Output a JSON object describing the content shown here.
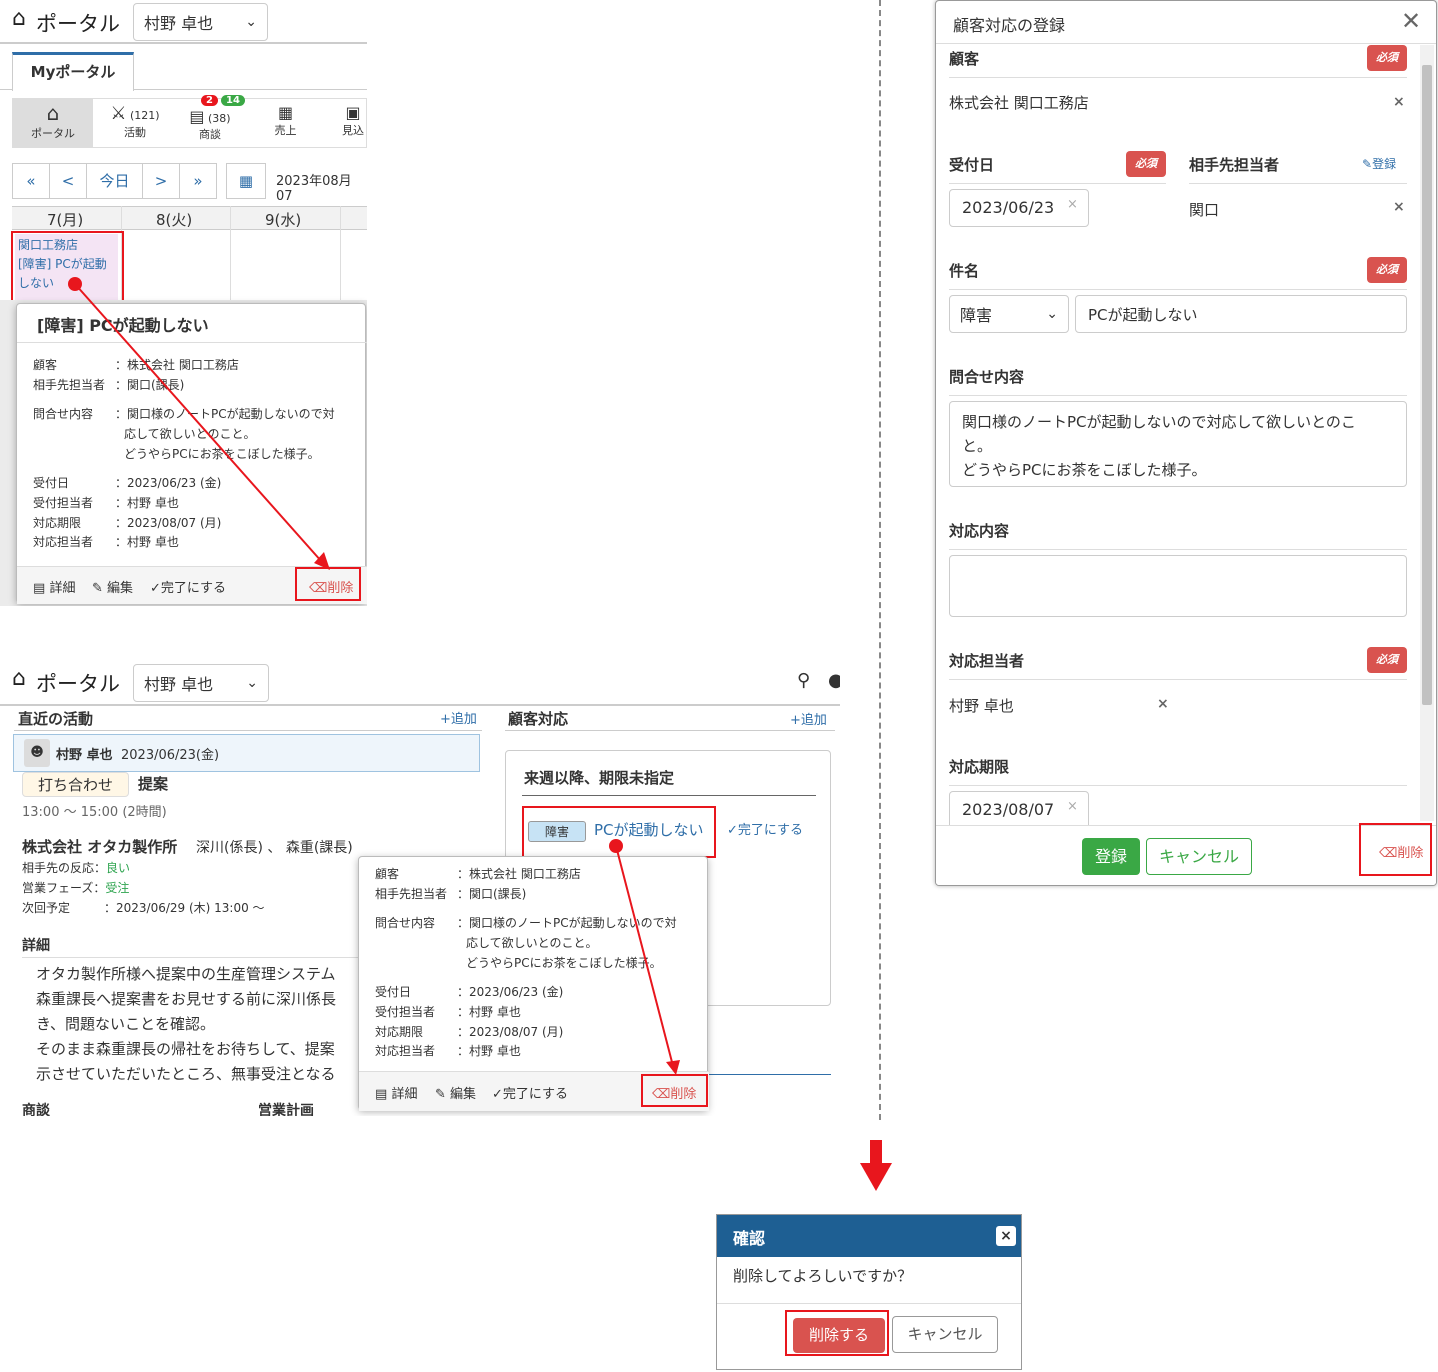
{
  "top_portal": {
    "title": "ポータル",
    "user_select": "村野 卓也",
    "tab": "Myポータル",
    "toolbar": [
      {
        "label": "ポータル",
        "count": ""
      },
      {
        "label": "活動",
        "count": "(121)"
      },
      {
        "label": "商談",
        "count": "(38)",
        "badge_red": "2",
        "badge_green": "14"
      },
      {
        "label": "売上",
        "count": ""
      },
      {
        "label": "見込",
        "count": ""
      }
    ],
    "nav": {
      "first": "«",
      "prev": "<",
      "today": "今日",
      "next": ">",
      "last": "»"
    },
    "date": "2023年08月07",
    "days": [
      "7(月)",
      "8(火)",
      "9(水)"
    ],
    "event_lines": [
      "関口工務店",
      "[障害] PCが起動",
      "しない"
    ],
    "popup": {
      "title": "[障害] PCが起動しない",
      "rows": [
        {
          "k": "顧客",
          "v": "：株式会社 関口工務店"
        },
        {
          "k": "相手先担当者",
          "v": "：関口(課長)"
        },
        {
          "k": "問合せ内容",
          "v": "：関口様のノートPCが起動しないので対"
        },
        {
          "k": "",
          "v": "応して欲しいとのこと。"
        },
        {
          "k": "",
          "v": "どうやらPCにお茶をこぼした様子。"
        },
        {
          "k": "受付日",
          "v": "：2023/06/23 (金)"
        },
        {
          "k": "受付担当者",
          "v": "：村野 卓也"
        },
        {
          "k": "対応期限",
          "v": "：2023/08/07 (月)"
        },
        {
          "k": "対応担当者",
          "v": "：村野 卓也"
        }
      ],
      "actions": {
        "detail": "詳細",
        "edit": "編集",
        "complete": "完了にする",
        "delete": "削除"
      }
    }
  },
  "bottom_portal": {
    "title": "ポータル",
    "user_select": "村野 卓也",
    "recent_title": "直近の活動",
    "add_label": "追加",
    "activity_user": "村野 卓也",
    "activity_date": "2023/06/23(金)",
    "activity_tag": "打ち合わせ",
    "activity_type": "提案",
    "activity_time": "13:00 ～ 15:00 (2時間)",
    "company": "株式会社 オタカ製作所",
    "contacts": "深川(係長) 、 森重(課長)",
    "reaction_label": "相手先の反応：",
    "reaction_value": "良い",
    "phase_label": "営業フェーズ：",
    "phase_value": "受注",
    "next_label": "次回予定",
    "next_value": "：2023/06/29 (木) 13:00 ～",
    "detail_title": "詳細",
    "detail_lines": [
      "オタカ製作所様へ提案中の生産管理システム",
      "森重課長へ提案書をお見せする前に深川係長",
      "き、問題ないことを確認。",
      "そのまま森重課長の帰社をお待ちして、提案",
      "示させていただいたところ、無事受注となる"
    ],
    "footer_left": "商談",
    "footer_right": "営業計画",
    "cs_title": "顧客対応",
    "cs_card_title": "来週以降、期限未指定",
    "cs_tag": "障害",
    "cs_link": "PCが起動しない",
    "cs_complete": "完了にする",
    "popup": {
      "rows": [
        {
          "k": "顧客",
          "v": "：株式会社 関口工務店"
        },
        {
          "k": "相手先担当者",
          "v": "：関口(課長)"
        },
        {
          "k": "問合せ内容",
          "v": "：関口様のノートPCが起動しないので対"
        },
        {
          "k": "",
          "v": "応して欲しいとのこと。"
        },
        {
          "k": "",
          "v": "どうやらPCにお茶をこぼした様子。"
        },
        {
          "k": "受付日",
          "v": "：2023/06/23 (金)"
        },
        {
          "k": "受付担当者",
          "v": "：村野 卓也"
        },
        {
          "k": "対応期限",
          "v": "：2023/08/07 (月)"
        },
        {
          "k": "対応担当者",
          "v": "：村野 卓也"
        }
      ],
      "actions": {
        "detail": "詳細",
        "edit": "編集",
        "complete": "完了にする",
        "delete": "削除"
      }
    }
  },
  "modal": {
    "title": "顧客対応の登録",
    "required": "必須",
    "customer_label": "顧客",
    "customer_value": "株式会社 関口工務店",
    "received_label": "受付日",
    "received_value": "2023/06/23",
    "contact_label": "相手先担当者",
    "contact_register": "登録",
    "contact_value": "関口",
    "subject_label": "件名",
    "subject_category": "障害",
    "subject_value": "PCが起動しない",
    "inquiry_label": "問合せ内容",
    "inquiry_lines": [
      "関口様のノートPCが起動しないので対応して欲しいとのこ",
      "と。",
      "どうやらPCにお茶をこぼした様子。"
    ],
    "response_label": "対応内容",
    "assignee_label": "対応担当者",
    "assignee_value": "村野 卓也",
    "deadline_label": "対応期限",
    "deadline_value": "2023/08/07",
    "save": "登録",
    "cancel": "キャンセル",
    "delete": "削除"
  },
  "confirm": {
    "title": "確認",
    "message": "削除してよろしいですか？",
    "ok": "削除する",
    "cancel": "キャンセル"
  },
  "colors": {
    "highlight": "#e8161d",
    "primary_green": "#3aa845",
    "required": "#d9534f",
    "link": "#2f6ea8",
    "confirm_header": "#1e5f93"
  }
}
